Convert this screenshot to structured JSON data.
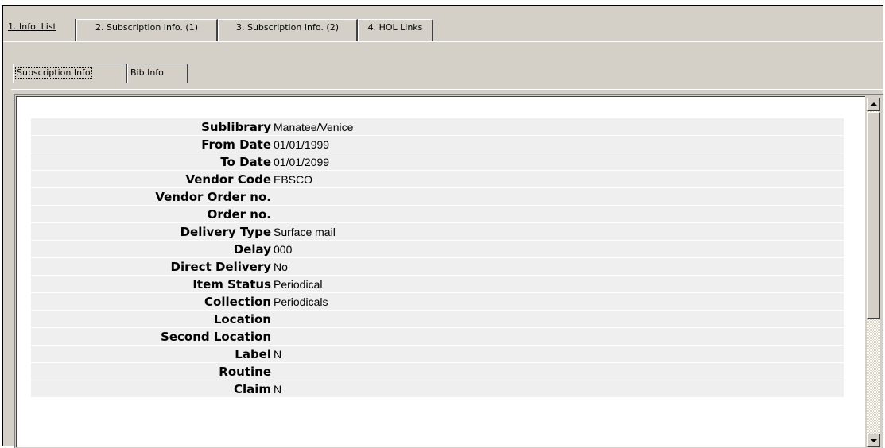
{
  "tabs": [
    {
      "label": "1. Info. List",
      "active": true
    },
    {
      "label": "2. Subscription Info. (1)",
      "active": false
    },
    {
      "label": "3. Subscription Info. (2)",
      "active": false
    },
    {
      "label": "4. HOL Links",
      "active": false
    }
  ],
  "subtabs": [
    {
      "label": "Subscription Info",
      "active": true
    },
    {
      "label": "Bib Info",
      "active": false
    }
  ],
  "fields": [
    {
      "label": "Sublibrary",
      "value": "Manatee/Venice"
    },
    {
      "label": "From Date",
      "value": "01/01/1999"
    },
    {
      "label": "To Date",
      "value": "01/01/2099"
    },
    {
      "label": "Vendor Code",
      "value": "EBSCO"
    },
    {
      "label": "Vendor Order no.",
      "value": ""
    },
    {
      "label": "Order no.",
      "value": ""
    },
    {
      "label": "Delivery Type",
      "value": "Surface mail"
    },
    {
      "label": "Delay",
      "value": "000"
    },
    {
      "label": "Direct Delivery",
      "value": "No"
    },
    {
      "label": "Item Status",
      "value": "Periodical"
    },
    {
      "label": "Collection",
      "value": "Periodicals"
    },
    {
      "label": "Location",
      "value": ""
    },
    {
      "label": "Second Location",
      "value": ""
    },
    {
      "label": "Label",
      "value": "N"
    },
    {
      "label": "Routine",
      "value": ""
    },
    {
      "label": "Claim",
      "value": "N"
    }
  ],
  "icons": {
    "scroll_up": "scroll-up-arrow-icon",
    "scroll_down": "scroll-down-arrow-icon"
  }
}
